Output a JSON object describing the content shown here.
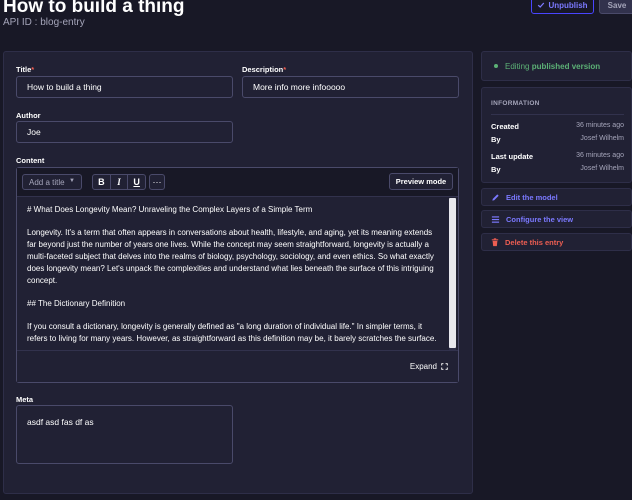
{
  "header": {
    "title": "How to build a thing",
    "subtitle": "API ID : blog-entry",
    "unpublish_label": "Unpublish",
    "save_label": "Save"
  },
  "form": {
    "title": {
      "label": "Title",
      "required_mark": "*",
      "value": "How to build a thing"
    },
    "description": {
      "label": "Description",
      "required_mark": "*",
      "value": "More info more infooooo"
    },
    "author": {
      "label": "Author",
      "value": "Joe"
    },
    "content": {
      "label": "Content",
      "toolbar": {
        "heading_select": "Add a title",
        "bold": "B",
        "italic": "I",
        "underline": "U",
        "more": "···",
        "preview_label": "Preview mode"
      },
      "paragraphs": [
        "# What Does Longevity Mean? Unraveling the Complex Layers of a Simple Term",
        "Longevity. It's a term that often appears in conversations about health, lifestyle, and aging, yet its meaning extends far beyond just the number of years one lives. While the concept may seem straightforward, longevity is actually a multi-faceted subject that delves into the realms of biology, psychology, sociology, and even ethics. So what exactly does longevity mean? Let's unpack the complexities and understand what lies beneath the surface of this intriguing concept.",
        "## The Dictionary Definition",
        "If you consult a dictionary, longevity is generally defined as \"a long duration of individual life.\" In simpler terms, it refers to living for many years. However, as straightforward as this definition may be, it barely scratches the surface."
      ],
      "expand_label": "Expand"
    },
    "meta": {
      "label": "Meta",
      "value": "asdf asd fas df as"
    }
  },
  "sidebar": {
    "status_prefix": "Editing",
    "status_bold": "published version",
    "info": {
      "title": "INFORMATION",
      "created_label": "Created",
      "created_value": "36 minutes ago",
      "created_by_label": "By",
      "created_by_value": "Josef Wilhelm",
      "updated_label": "Last update",
      "updated_value": "36 minutes ago",
      "updated_by_label": "By",
      "updated_by_value": "Josef Wilhelm"
    },
    "edit_model_label": "Edit the model",
    "configure_view_label": "Configure the view",
    "delete_label": "Delete this entry"
  },
  "colors": {
    "background": "#181826",
    "surface": "#212134",
    "accent": "#7b79ff",
    "success": "#5cb176",
    "danger": "#ee5e52"
  }
}
